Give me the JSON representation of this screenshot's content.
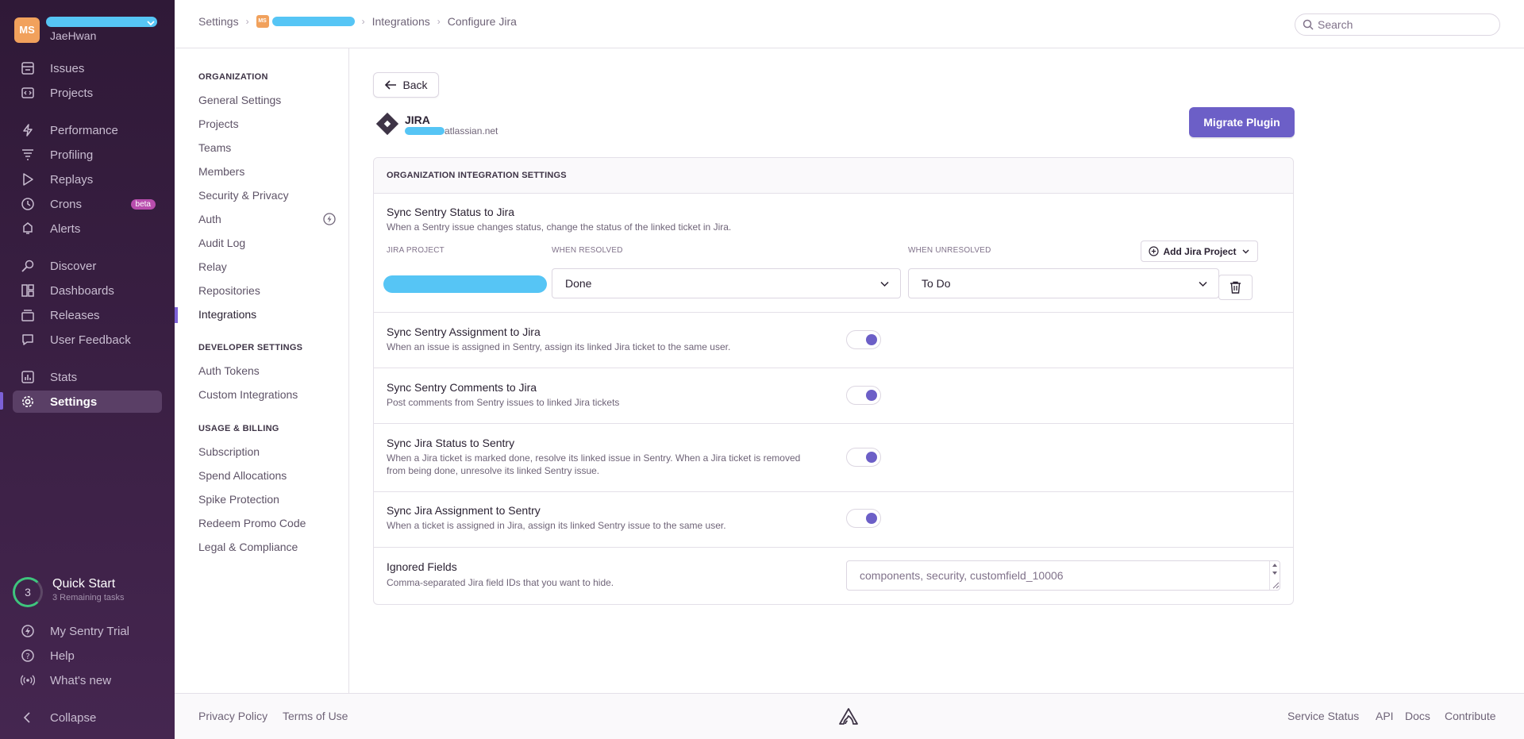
{
  "sidebar": {
    "org_initials": "MS",
    "org_user": "JaeHwan",
    "nav_main": [
      {
        "label": "Issues",
        "icon": "issues-icon"
      },
      {
        "label": "Projects",
        "icon": "projects-icon"
      }
    ],
    "nav_perf": [
      {
        "label": "Performance",
        "icon": "performance-icon"
      },
      {
        "label": "Profiling",
        "icon": "profiling-icon"
      },
      {
        "label": "Replays",
        "icon": "replays-icon"
      },
      {
        "label": "Crons",
        "icon": "crons-icon",
        "badge": "beta"
      },
      {
        "label": "Alerts",
        "icon": "alerts-icon"
      }
    ],
    "nav_analyze": [
      {
        "label": "Discover",
        "icon": "discover-icon"
      },
      {
        "label": "Dashboards",
        "icon": "dashboards-icon"
      },
      {
        "label": "Releases",
        "icon": "releases-icon"
      },
      {
        "label": "User Feedback",
        "icon": "feedback-icon"
      }
    ],
    "nav_settings": [
      {
        "label": "Stats",
        "icon": "stats-icon"
      },
      {
        "label": "Settings",
        "icon": "settings-icon",
        "active": true
      }
    ],
    "quick_start": {
      "count": "3",
      "title": "Quick Start",
      "subtitle": "3 Remaining tasks"
    },
    "bottom": [
      {
        "label": "My Sentry Trial",
        "icon": "trial-icon"
      },
      {
        "label": "Help",
        "icon": "help-icon"
      },
      {
        "label": "What's new",
        "icon": "broadcast-icon"
      }
    ],
    "collapse_label": "Collapse"
  },
  "topbar": {
    "breadcrumbs": {
      "settings": "Settings",
      "org_badge": "MS",
      "integrations": "Integrations",
      "current": "Configure Jira"
    },
    "search_placeholder": "Search"
  },
  "settings_nav": {
    "organization_heading": "ORGANIZATION",
    "organization_items": [
      "General Settings",
      "Projects",
      "Teams",
      "Members",
      "Security & Privacy",
      "Auth",
      "Audit Log",
      "Relay",
      "Repositories",
      "Integrations"
    ],
    "developer_heading": "DEVELOPER SETTINGS",
    "developer_items": [
      "Auth Tokens",
      "Custom Integrations"
    ],
    "billing_heading": "USAGE & BILLING",
    "billing_items": [
      "Subscription",
      "Spend Allocations",
      "Spike Protection",
      "Redeem Promo Code",
      "Legal & Compliance"
    ],
    "active_item": "Integrations"
  },
  "main": {
    "back_label": "Back",
    "integration_name": "JIRA",
    "integration_domain_suffix": "atlassian.net",
    "migrate_label": "Migrate Plugin",
    "panel_title": "ORGANIZATION INTEGRATION SETTINGS",
    "sync_status": {
      "title": "Sync Sentry Status to Jira",
      "desc": "When a Sentry issue changes status, change the status of the linked ticket in Jira.",
      "col_project": "JIRA PROJECT",
      "col_resolved": "WHEN RESOLVED",
      "col_unresolved": "WHEN UNRESOLVED",
      "add_project_label": "Add Jira Project",
      "resolved_value": "Done",
      "unresolved_value": "To Do"
    },
    "toggles": [
      {
        "title": "Sync Sentry Assignment to Jira",
        "desc": "When an issue is assigned in Sentry, assign its linked Jira ticket to the same user.",
        "on": true
      },
      {
        "title": "Sync Sentry Comments to Jira",
        "desc": "Post comments from Sentry issues to linked Jira tickets",
        "on": true
      },
      {
        "title": "Sync Jira Status to Sentry",
        "desc": "When a Jira ticket is marked done, resolve its linked issue in Sentry. When a Jira ticket is removed from being done, unresolve its linked Sentry issue.",
        "on": true
      },
      {
        "title": "Sync Jira Assignment to Sentry",
        "desc": "When a ticket is assigned in Jira, assign its linked Sentry issue to the same user.",
        "on": true
      }
    ],
    "ignored_fields": {
      "title": "Ignored Fields",
      "desc": "Comma-separated Jira field IDs that you want to hide.",
      "placeholder": "components, security, customfield_10006"
    }
  },
  "footer": {
    "left_links": [
      "Privacy Policy",
      "Terms of Use"
    ],
    "right_links": [
      "Service Status",
      "API",
      "Docs",
      "Contribute"
    ]
  },
  "colors": {
    "accent": "#6c5fc7",
    "sidebar_top": "#2f1937",
    "sidebar_bottom": "#452650",
    "redaction": "#56c5f5"
  }
}
